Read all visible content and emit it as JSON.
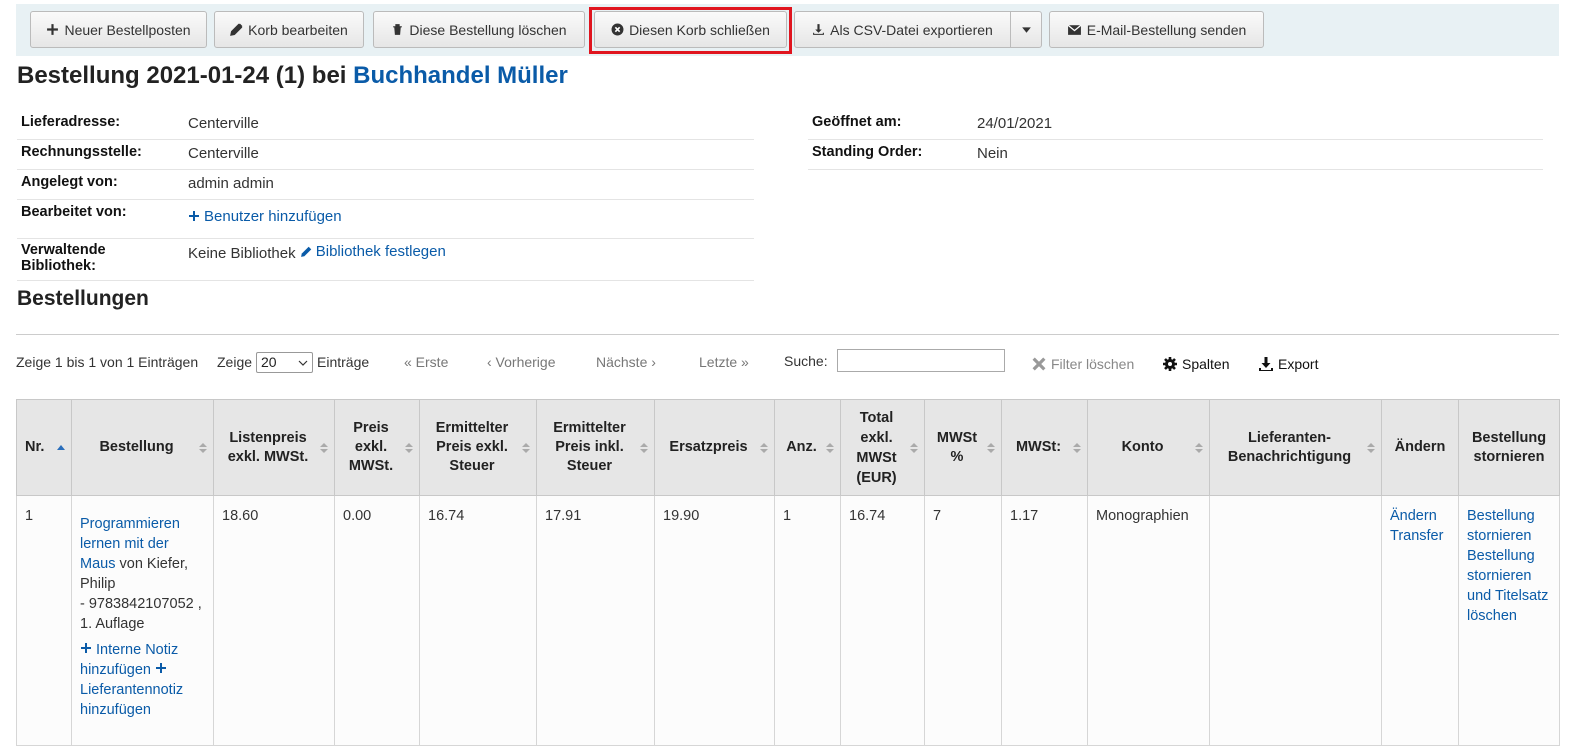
{
  "toolbar": {
    "new_item": "Neuer Bestellposten",
    "edit_basket": "Korb bearbeiten",
    "delete_order": "Diese Bestellung löschen",
    "close_basket": "Diesen Korb schließen",
    "export_csv": "Als CSV-Datei exportieren",
    "email_order": "E-Mail-Bestellung senden"
  },
  "header": {
    "title_prefix": "Bestellung 2021-01-24 (1) bei",
    "vendor": "Buchhandel Müller"
  },
  "info_left": {
    "delivery_label": "Lieferadresse:",
    "delivery_value": "Centerville",
    "billing_label": "Rechnungsstelle:",
    "billing_value": "Centerville",
    "created_label": "Angelegt von:",
    "created_value": "admin admin",
    "edited_label": "Bearbeitet von:",
    "edited_link": "Benutzer hinzufügen",
    "library_label": "Verwaltende Bibliothek:",
    "library_value": "Keine Bibliothek",
    "library_link": "Bibliothek festlegen"
  },
  "info_right": {
    "opened_label": "Geöffnet am:",
    "opened_value": "24/01/2021",
    "standing_label": "Standing Order:",
    "standing_value": "Nein"
  },
  "orders": {
    "heading": "Bestellungen",
    "info": "Zeige 1 bis 1 von 1 Einträgen",
    "show_label": "Zeige",
    "page_size": "20",
    "entries_label": "Einträge",
    "first": "« Erste",
    "prev": "‹ Vorherige",
    "next": "Nächste ›",
    "last": "Letzte »",
    "search_label": "Suche:",
    "clear_filter": "Filter löschen",
    "columns": "Spalten",
    "export": "Export"
  },
  "table": {
    "headers": {
      "nr": "Nr.",
      "order": "Bestellung",
      "list_price": "Listenpreis exkl. MWSt.",
      "price": "Preis exkl. MWSt.",
      "est_excl": "Ermittelter Preis exkl. Steuer",
      "est_incl": "Ermittelter Preis inkl. Steuer",
      "replacement": "Ersatzpreis",
      "qty": "Anz.",
      "total": "Total exkl. MWSt (EUR)",
      "tax_pct": "MWSt %",
      "tax": "MWSt:",
      "fund": "Konto",
      "vendor_note": "Lieferanten-Benachrichtigung",
      "modify": "Ändern",
      "cancel": "Bestellung stornieren"
    },
    "row": {
      "nr": "1",
      "title": "Programmieren lernen mit der Maus",
      "author": "von Kiefer, Philip",
      "isbn": "- 9783842107052 , 1. Auflage",
      "internal_note": "Interne Notiz hinzufügen",
      "vendor_note_link": "Lieferantennotiz hinzufügen",
      "list_price": "18.60",
      "price": "0.00",
      "est_excl": "16.74",
      "est_incl": "17.91",
      "replacement": "19.90",
      "qty": "1",
      "total": "16.74",
      "tax_pct": "7",
      "tax": "1.17",
      "fund": "Monographien",
      "vendor_note": "",
      "modify_link": "Ändern",
      "transfer_link": "Transfer",
      "cancel_link": "Bestellung stornieren",
      "cancel_delete_link": "Bestellung stornieren und Titelsatz löschen"
    }
  }
}
